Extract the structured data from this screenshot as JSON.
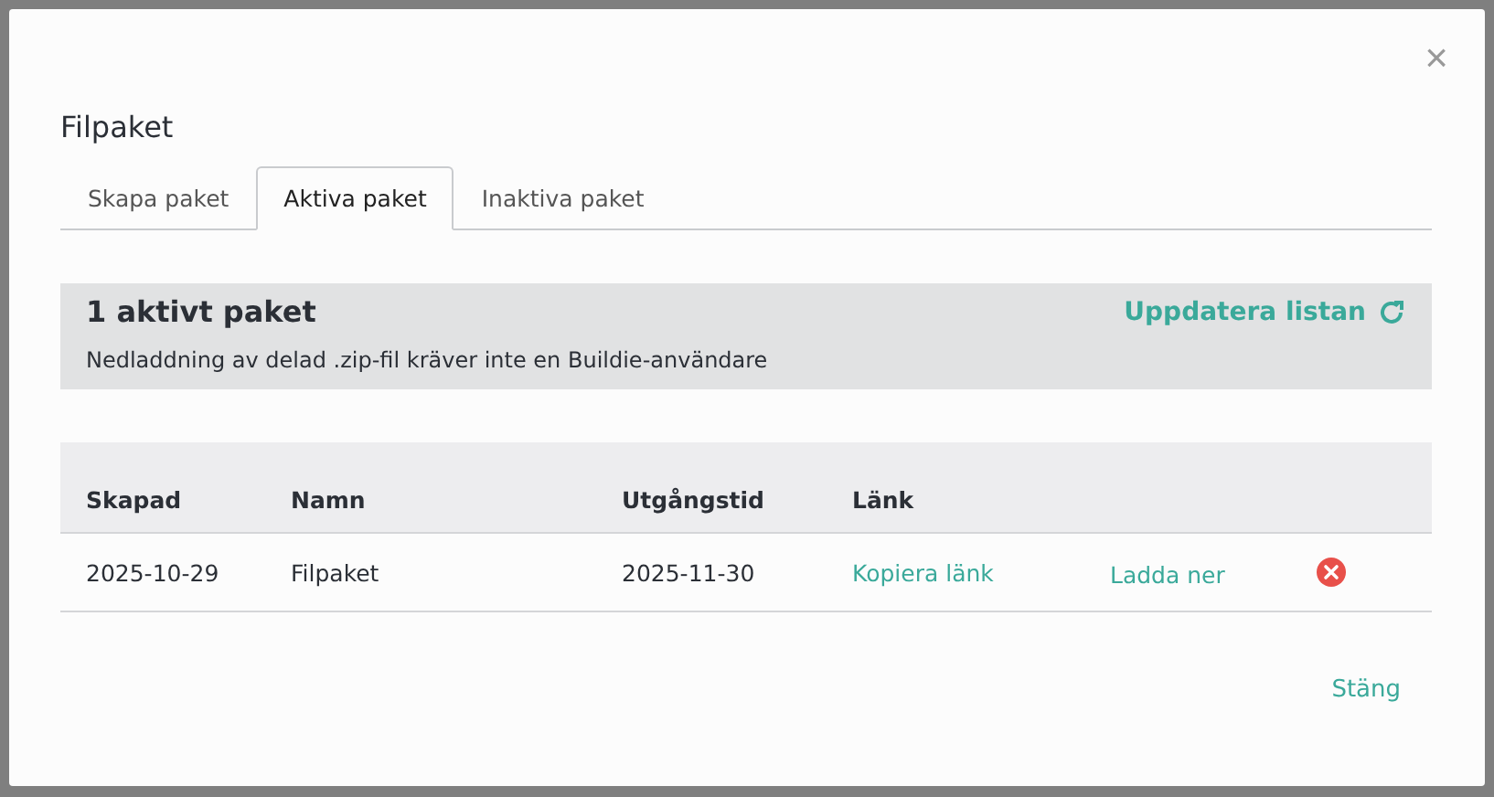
{
  "dialog": {
    "title": "Filpaket",
    "close": "×"
  },
  "tabs": [
    {
      "label": "Skapa paket",
      "selected": false
    },
    {
      "label": "Aktiva paket",
      "selected": true
    },
    {
      "label": "Inaktiva paket",
      "selected": false
    }
  ],
  "summary": {
    "heading": "1 aktivt paket",
    "refresh": "Uppdatera listan",
    "note": "Nedladdning av delad .zip-fil kräver inte en Buildie-användare"
  },
  "table": {
    "columns": [
      "Skapad",
      "Namn",
      "Utgångstid",
      "Länk"
    ],
    "rows": [
      {
        "created": "2025-10-29",
        "name": "Filpaket",
        "expires": "2025-11-30",
        "copy_link": "Kopiera länk",
        "download": "Ladda ner"
      }
    ]
  },
  "footer": {
    "close_button": "Stäng"
  }
}
